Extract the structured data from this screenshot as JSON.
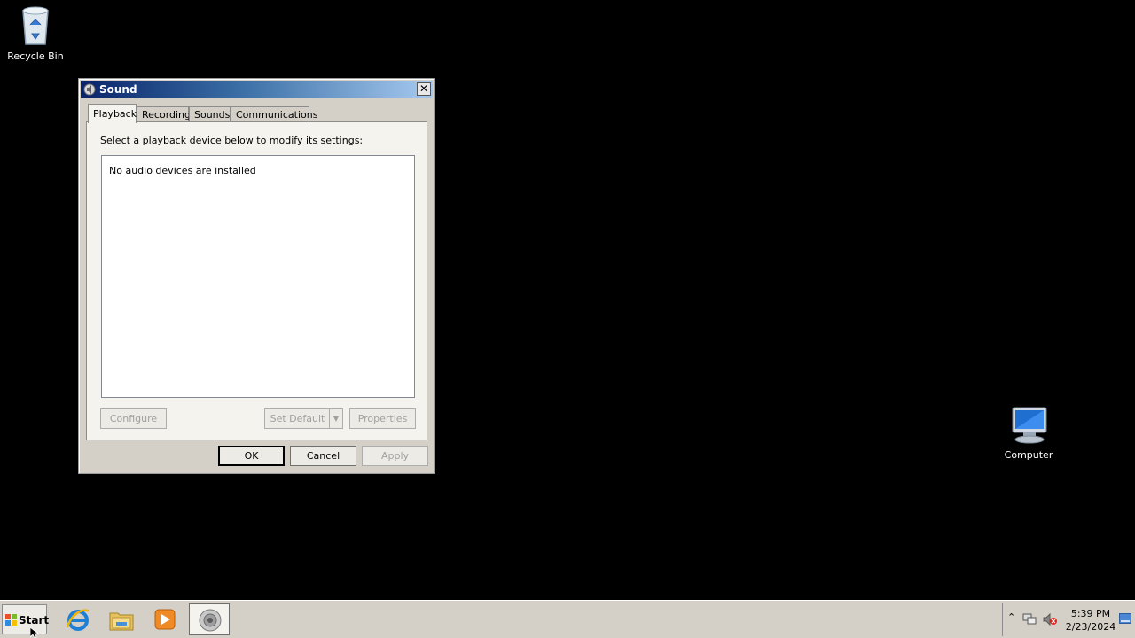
{
  "desktop": {
    "recycle_bin_label": "Recycle Bin",
    "computer_label": "Computer"
  },
  "dialog": {
    "title": "Sound",
    "close_symbol": "✕",
    "tabs": [
      {
        "label": "Playback",
        "active": true
      },
      {
        "label": "Recording",
        "active": false
      },
      {
        "label": "Sounds",
        "active": false
      },
      {
        "label": "Communications",
        "active": false
      }
    ],
    "instruction": "Select a playback device below to modify its settings:",
    "device_list_empty_text": "No audio devices are installed",
    "buttons": {
      "configure": "Configure",
      "set_default": "Set Default",
      "properties": "Properties",
      "ok": "OK",
      "cancel": "Cancel",
      "apply": "Apply"
    }
  },
  "taskbar": {
    "start_label": "Start",
    "pinned": [
      {
        "name": "internet-explorer-icon"
      },
      {
        "name": "windows-explorer-icon"
      },
      {
        "name": "media-player-icon"
      },
      {
        "name": "sound-icon",
        "active": true
      }
    ],
    "tray": {
      "expand_symbol": "⌃",
      "time": "5:39 PM",
      "date": "2/23/2024"
    }
  },
  "colors": {
    "desktop_bg": "#000000",
    "dialog_bg": "#d4d0c8",
    "title_gradient_start": "#0a246a",
    "title_gradient_end": "#a6caf0"
  }
}
